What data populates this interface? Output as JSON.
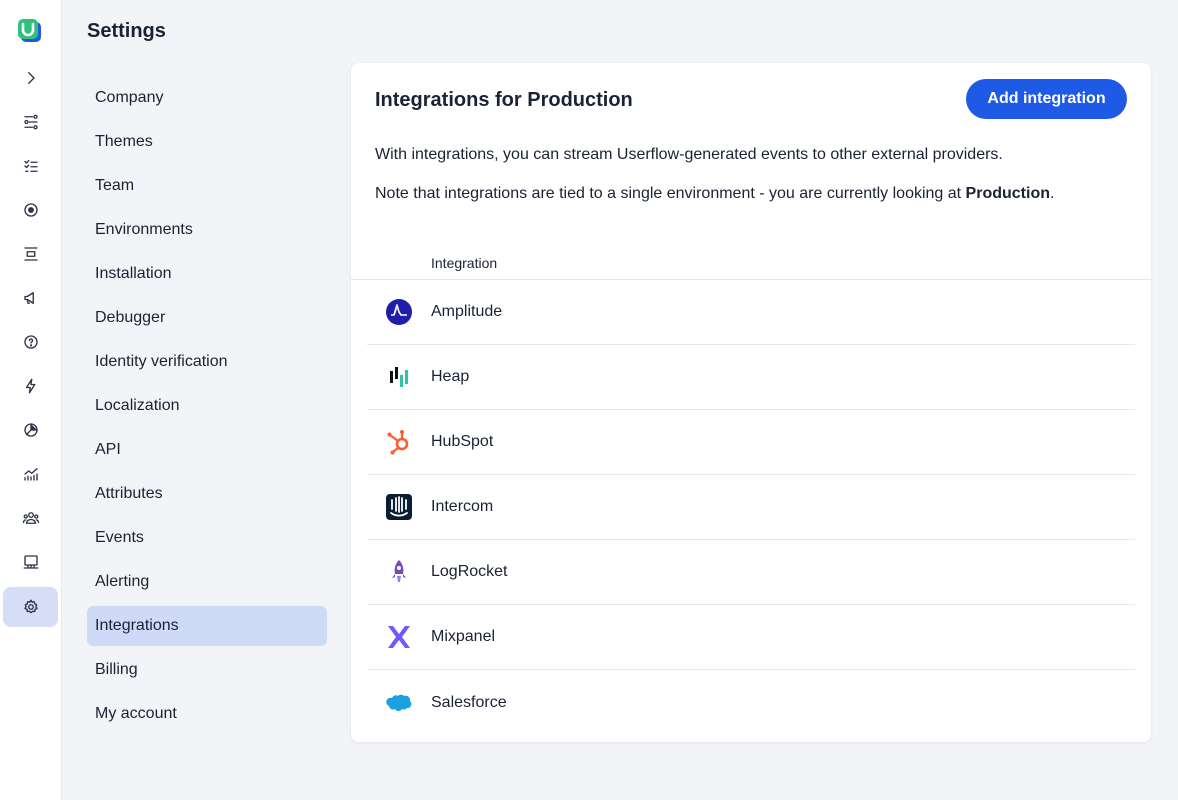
{
  "rail": {
    "icons": [
      "chevron-right-icon",
      "flows-icon",
      "checklist-icon",
      "target-icon",
      "banner-icon",
      "megaphone-icon",
      "help-icon",
      "bolt-icon",
      "pie-chart-icon",
      "analytics-icon",
      "users-icon",
      "companies-icon",
      "gear-icon"
    ],
    "active": "gear-icon"
  },
  "settings": {
    "title": "Settings",
    "nav": [
      {
        "label": "Company"
      },
      {
        "label": "Themes"
      },
      {
        "label": "Team"
      },
      {
        "label": "Environments"
      },
      {
        "label": "Installation"
      },
      {
        "label": "Debugger"
      },
      {
        "label": "Identity verification"
      },
      {
        "label": "Localization"
      },
      {
        "label": "API"
      },
      {
        "label": "Attributes"
      },
      {
        "label": "Events"
      },
      {
        "label": "Alerting"
      },
      {
        "label": "Integrations"
      },
      {
        "label": "Billing"
      },
      {
        "label": "My account"
      }
    ],
    "active": "Integrations"
  },
  "main": {
    "title": "Integrations for Production",
    "add_button": "Add integration",
    "description": "With integrations, you can stream Userflow-generated events to other external providers.",
    "note_prefix": "Note that integrations are tied to a single environment - you are currently looking at ",
    "note_env": "Production",
    "note_suffix": ".",
    "column_header": "Integration",
    "integrations": [
      {
        "label": "Amplitude",
        "icon": "amplitude-logo-icon"
      },
      {
        "label": "Heap",
        "icon": "heap-logo-icon"
      },
      {
        "label": "HubSpot",
        "icon": "hubspot-logo-icon"
      },
      {
        "label": "Intercom",
        "icon": "intercom-logo-icon"
      },
      {
        "label": "LogRocket",
        "icon": "logrocket-logo-icon"
      },
      {
        "label": "Mixpanel",
        "icon": "mixpanel-logo-icon"
      },
      {
        "label": "Salesforce",
        "icon": "salesforce-logo-icon"
      }
    ]
  },
  "colors": {
    "accent": "#1e5ae6",
    "active_nav": "#cfdaf6",
    "active_rail": "#d5ddf7",
    "background": "#f2f4f7",
    "logo_green": "#2fc27a"
  }
}
